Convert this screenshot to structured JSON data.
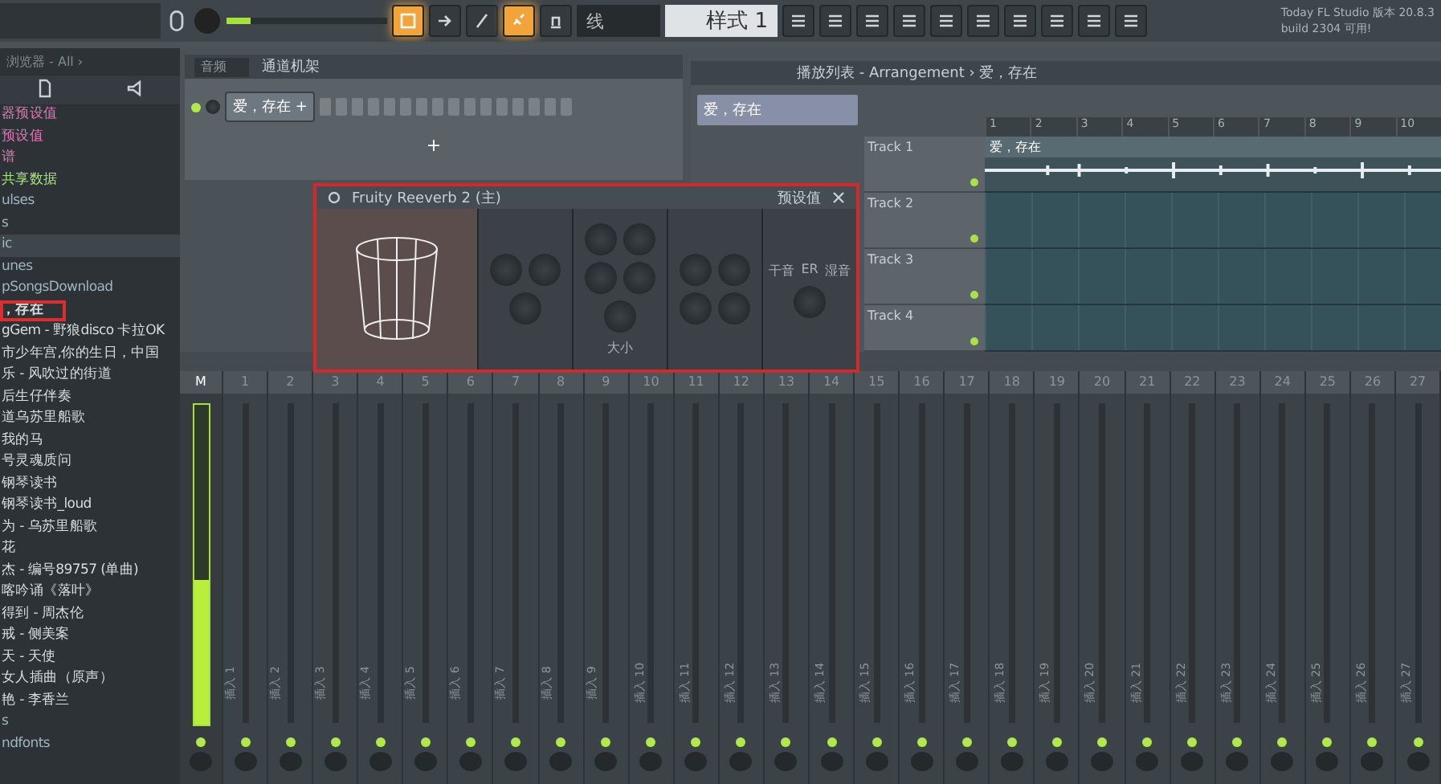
{
  "toolbar": {
    "slider": {
      "level": 0.15
    },
    "transport": [
      {
        "selected": true
      },
      {
        "selected": false
      },
      {
        "selected": false
      },
      {
        "selected": true
      },
      {
        "selected": false
      }
    ],
    "snap": "线",
    "pattern": "样式 1",
    "news": [
      "Today  FL Studio 版本 20.8.3",
      "build 2304 可用!"
    ]
  },
  "browser": {
    "title": "浏览器 - All ›",
    "items": [
      {
        "label": "器预设值",
        "kind": "preset",
        "selected": false
      },
      {
        "label": "预设值",
        "kind": "preset",
        "selected": false
      },
      {
        "label": "谱",
        "kind": "preset",
        "selected": false
      },
      {
        "label": "共享数据",
        "kind": "shared",
        "selected": false
      },
      {
        "label": "ulses",
        "kind": "folder",
        "selected": false
      },
      {
        "label": "s",
        "kind": "folder",
        "selected": false
      },
      {
        "label": "ic",
        "kind": "folder",
        "selected": true
      },
      {
        "label": "unes",
        "kind": "folder",
        "selected": false
      },
      {
        "label": "pSongsDownload",
        "kind": "folder",
        "selected": false
      },
      {
        "label": "，存在",
        "kind": "file",
        "selected": false,
        "highlighted": true
      },
      {
        "label": "gGem - 野狼disco 卡拉OK",
        "kind": "file",
        "selected": false
      },
      {
        "label": "市少年宫,你的生日，中国",
        "kind": "file",
        "selected": false
      },
      {
        "label": "乐 - 风吹过的街道",
        "kind": "file",
        "selected": false
      },
      {
        "label": "后生仔伴奏",
        "kind": "file",
        "selected": false
      },
      {
        "label": "道乌苏里船歌",
        "kind": "file",
        "selected": false
      },
      {
        "label": "我的马",
        "kind": "file",
        "selected": false
      },
      {
        "label": "号灵魂质问",
        "kind": "file",
        "selected": false
      },
      {
        "label": "钢琴读书",
        "kind": "file",
        "selected": false
      },
      {
        "label": "钢琴读书_loud",
        "kind": "file",
        "selected": false
      },
      {
        "label": "为 - 乌苏里船歌",
        "kind": "file",
        "selected": false
      },
      {
        "label": "花",
        "kind": "file",
        "selected": false
      },
      {
        "label": "杰 - 编号89757 (单曲)",
        "kind": "file",
        "selected": false
      },
      {
        "label": "喀吟诵《落叶》",
        "kind": "file",
        "selected": false
      },
      {
        "label": "得到 - 周杰伦",
        "kind": "file",
        "selected": false
      },
      {
        "label": "戒 - 侧美案",
        "kind": "file",
        "selected": false
      },
      {
        "label": "天 - 天使",
        "kind": "file",
        "selected": false
      },
      {
        "label": "女人插曲（原声）",
        "kind": "file",
        "selected": false
      },
      {
        "label": "艳 - 李香兰",
        "kind": "file",
        "selected": false
      },
      {
        "label": "s",
        "kind": "folder",
        "selected": false
      },
      {
        "label": "ndfonts",
        "kind": "folder",
        "selected": false
      }
    ]
  },
  "channel_rack": {
    "group": "音频",
    "title": "通道机架",
    "channels": [
      {
        "name": "爱，存在",
        "plus": "+"
      }
    ],
    "add": "+"
  },
  "playlist": {
    "title": "播放列表 - Arrangement › 爱，存在",
    "clip_picker": "爱，存在",
    "ruler": [
      "1",
      "2",
      "3",
      "4",
      "5",
      "6",
      "7",
      "8",
      "9",
      "10"
    ],
    "tracks": [
      {
        "name": "Track 1",
        "clip": "爱，存在"
      },
      {
        "name": "Track 2"
      },
      {
        "name": "Track 3"
      },
      {
        "name": "Track 4"
      }
    ]
  },
  "plugin": {
    "title": "Fruity Reeverb 2",
    "suffix": "(主)",
    "preset": "预设值",
    "labels": [
      "大小",
      "干音",
      "ER",
      "湿音"
    ]
  },
  "mixer": {
    "master": {
      "label": "M",
      "level": 0.45
    },
    "inserts": [
      {
        "number": "1",
        "label": "插入 1"
      },
      {
        "number": "2",
        "label": "插入 2"
      },
      {
        "number": "3",
        "label": "插入 3"
      },
      {
        "number": "4",
        "label": "插入 4"
      },
      {
        "number": "5",
        "label": "插入 5"
      },
      {
        "number": "6",
        "label": "插入 6"
      },
      {
        "number": "7",
        "label": "插入 7"
      },
      {
        "number": "8",
        "label": "插入 8"
      },
      {
        "number": "9",
        "label": "插入 9"
      },
      {
        "number": "10",
        "label": "插入 10"
      },
      {
        "number": "11",
        "label": "插入 11"
      },
      {
        "number": "12",
        "label": "插入 12"
      },
      {
        "number": "13",
        "label": "插入 13"
      },
      {
        "number": "14",
        "label": "插入 14"
      },
      {
        "number": "15",
        "label": "插入 15"
      },
      {
        "number": "16",
        "label": "插入 16"
      },
      {
        "number": "17",
        "label": "插入 17"
      },
      {
        "number": "18",
        "label": "插入 18"
      },
      {
        "number": "19",
        "label": "插入 19"
      },
      {
        "number": "20",
        "label": "插入 20"
      },
      {
        "number": "21",
        "label": "插入 21"
      },
      {
        "number": "22",
        "label": "插入 22"
      },
      {
        "number": "23",
        "label": "插入 23"
      },
      {
        "number": "24",
        "label": "插入 24"
      },
      {
        "number": "25",
        "label": "插入 25"
      },
      {
        "number": "26",
        "label": "插入 26"
      },
      {
        "number": "27",
        "label": "插入 27"
      }
    ]
  }
}
